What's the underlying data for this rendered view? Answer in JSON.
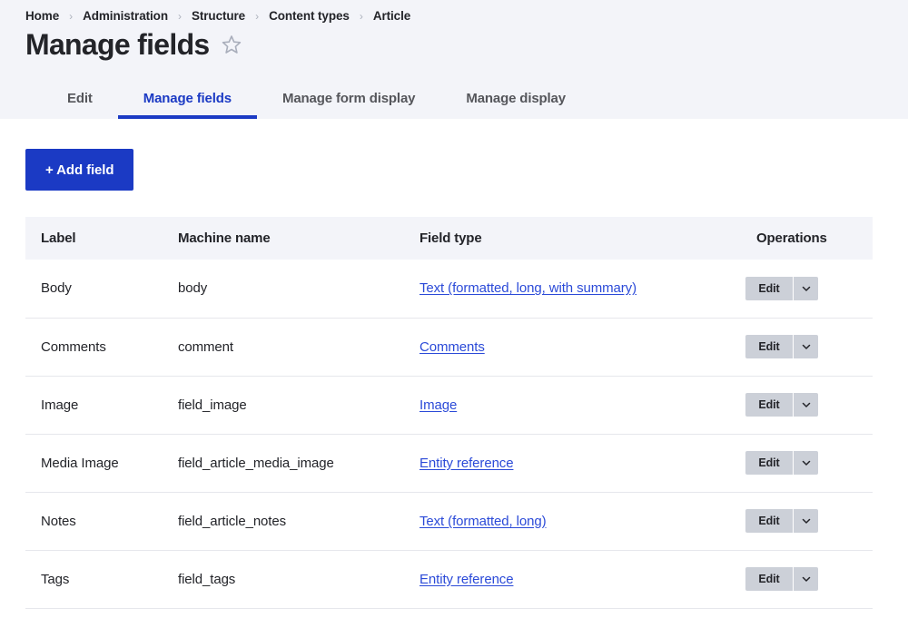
{
  "breadcrumb": {
    "separator": "›",
    "items": [
      {
        "label": "Home"
      },
      {
        "label": "Administration"
      },
      {
        "label": "Structure"
      },
      {
        "label": "Content types"
      },
      {
        "label": "Article"
      }
    ]
  },
  "header": {
    "title": "Manage fields",
    "star_icon": "star-outline-icon"
  },
  "tabs": [
    {
      "label": "Edit",
      "active": false
    },
    {
      "label": "Manage fields",
      "active": true
    },
    {
      "label": "Manage form display",
      "active": false
    },
    {
      "label": "Manage display",
      "active": false
    }
  ],
  "toolbar": {
    "add_field_label": "+ Add field"
  },
  "table": {
    "columns": [
      "Label",
      "Machine name",
      "Field type",
      "Operations"
    ],
    "rows": [
      {
        "label": "Body",
        "machine_name": "body",
        "field_type": "Text (formatted, long, with summary)",
        "edit_label": "Edit"
      },
      {
        "label": "Comments",
        "machine_name": "comment",
        "field_type": "Comments",
        "edit_label": "Edit"
      },
      {
        "label": "Image",
        "machine_name": "field_image",
        "field_type": "Image",
        "edit_label": "Edit"
      },
      {
        "label": "Media Image",
        "machine_name": "field_article_media_image",
        "field_type": "Entity reference",
        "edit_label": "Edit"
      },
      {
        "label": "Notes",
        "machine_name": "field_article_notes",
        "field_type": "Text (formatted, long)",
        "edit_label": "Edit"
      },
      {
        "label": "Tags",
        "machine_name": "field_tags",
        "field_type": "Entity reference",
        "edit_label": "Edit"
      }
    ]
  },
  "colors": {
    "accent": "#1b3ac4",
    "link": "#2b4ad8",
    "header_band": "#f3f4f9",
    "button_gray": "#ccd0d8",
    "text": "#232429",
    "row_border": "#e6e7ec"
  }
}
